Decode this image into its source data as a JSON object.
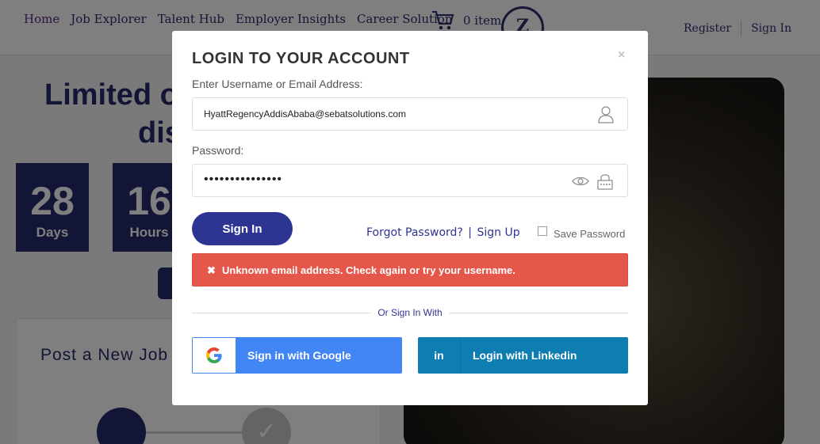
{
  "nav": {
    "items": [
      "Home",
      "Job Explorer",
      "Talent Hub",
      "Employer Insights",
      "Career Solution"
    ],
    "cart_count": "0 item",
    "badge": "Z",
    "register": "Register",
    "sign_in": "Sign In"
  },
  "promo": {
    "title_line1": "Limited o",
    "title_line2": "dis",
    "countdown": [
      {
        "value": "28",
        "unit": "Days"
      },
      {
        "value": "16",
        "unit": "Hours"
      }
    ]
  },
  "post_panel": {
    "title": "Post a New Job"
  },
  "modal": {
    "title": "LOGIN TO YOUR ACCOUNT",
    "close": "×",
    "username_label": "Enter Username or Email Address:",
    "username_value": "HyattRegencyAddisAbaba@sebatsolutions.com",
    "password_label": "Password:",
    "password_value": "•••••••••••••••",
    "sign_in_button": "Sign In",
    "forgot_password": "Forgot Password?",
    "link_separator": "|",
    "sign_up": "Sign Up",
    "save_password": "Save Password",
    "error_icon": "✖",
    "error_message": "Unknown email address. Check again or try your username.",
    "or_sign_in_with": "Or Sign In With",
    "google_button": "Sign in with Google",
    "linkedin_icon": "in",
    "linkedin_button": "Login with Linkedin"
  },
  "colors": {
    "primary": "#2e3492",
    "error": "#e4574a",
    "google": "#4285f4",
    "linkedin": "#0e7db2"
  }
}
